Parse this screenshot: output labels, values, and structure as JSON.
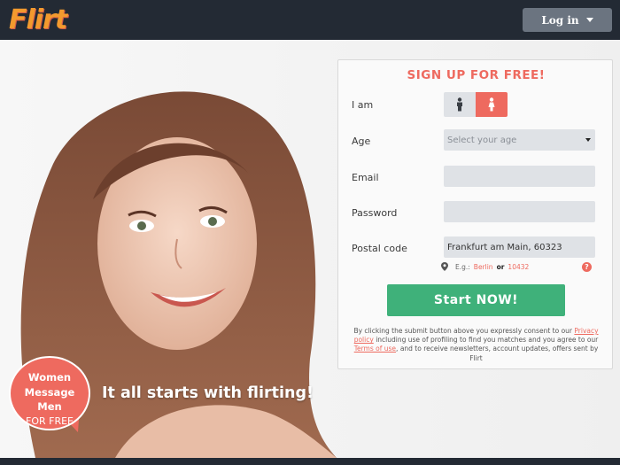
{
  "header": {
    "logo_text": "Flirt",
    "login_label": "Log in"
  },
  "hero": {
    "bubble_lines": [
      "Women",
      "Message",
      "Men",
      "FOR FREE"
    ],
    "tagline": "It all starts with flirting!"
  },
  "form": {
    "title": "SIGN UP FOR FREE!",
    "labels": {
      "iam": "I am",
      "age": "Age",
      "email": "Email",
      "password": "Password",
      "postal": "Postal code"
    },
    "age_placeholder": "Select your age",
    "email_value": "",
    "password_value": "",
    "postal_value": "Frankfurt am Main, 60323",
    "hint": {
      "prefix": "E.g.:",
      "city": "Berlin",
      "or": "or",
      "code": "10432"
    },
    "help_mark": "?",
    "submit_label": "Start NOW!",
    "terms": {
      "part1": "By clicking the submit button above you expressly consent to our",
      "privacy_link": "Privacy policy",
      "part2": "including use of profiling to find you matches and you agree to our",
      "terms_link": "Terms of use",
      "part3": ", and to receive newsletters, account updates, offers sent by Flirt"
    }
  },
  "colors": {
    "accent": "#ee6a5f",
    "header_bg": "#232a34",
    "button_green": "#3fb17a",
    "logo_orange": "#f39a2e"
  },
  "icons": {
    "male": "male-icon",
    "female": "female-icon",
    "location": "location-pin-icon"
  }
}
